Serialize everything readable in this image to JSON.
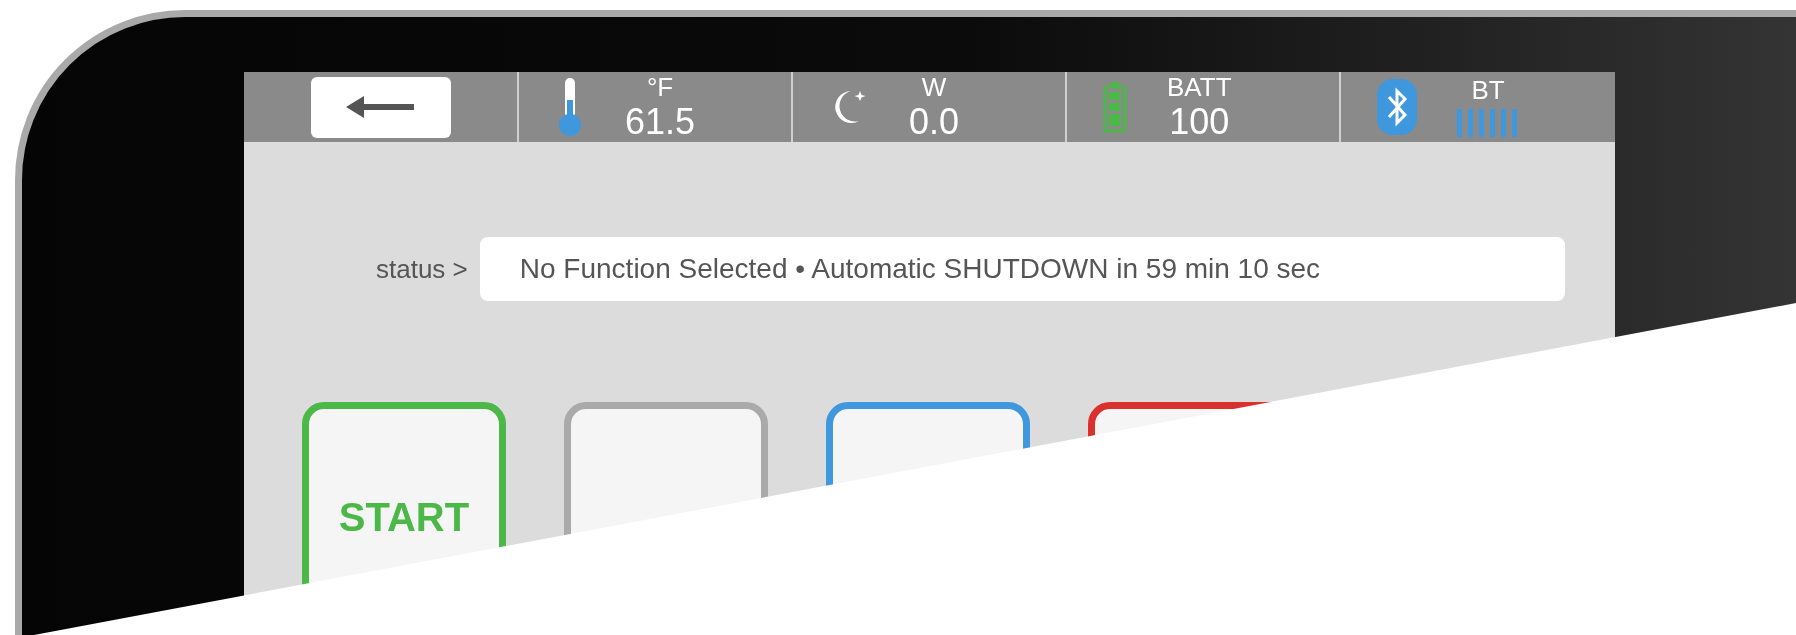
{
  "top_bar": {
    "readings": [
      {
        "kind": "temperature",
        "unit": "°F",
        "value": "61.5"
      },
      {
        "kind": "night",
        "unit": "W",
        "value": "0.0"
      },
      {
        "kind": "battery",
        "unit": "BATT",
        "value": "100"
      },
      {
        "kind": "bluetooth",
        "unit": "BT"
      }
    ]
  },
  "status": {
    "label": "status >",
    "text": "No Function Selected • Automatic SHUTDOWN in 59 min 10 sec"
  },
  "buttons": [
    {
      "label": "START",
      "color": "#4cb848"
    },
    {
      "color": "#aaaaaa"
    },
    {
      "color": "#3f97de"
    },
    {
      "color": "#d9322e"
    }
  ]
}
